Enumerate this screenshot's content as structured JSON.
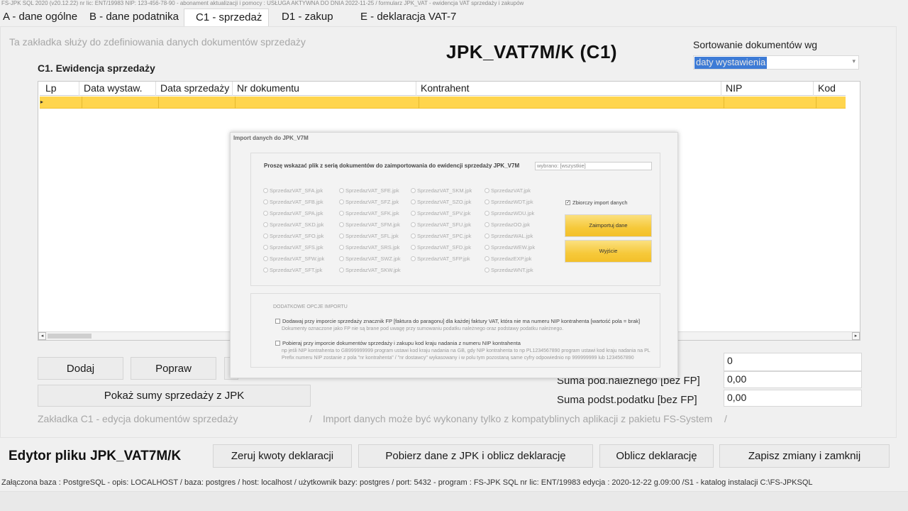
{
  "window": {
    "title": "FS-JPK SQL 2020  (v20.12.22)    nr lic: ENT/19983     NIP: 123-456-78-90      -     abonament aktualizacji i pomocy : USŁUGA AKTYWNA DO DNIA 2022-11-25      /      formularz JPK_VAT - ewidencja VAT sprzedaży i zakupów"
  },
  "tabs": [
    {
      "label": "A - dane ogólne"
    },
    {
      "label": "B   - dane podatnika"
    },
    {
      "label": "C1  - sprzedaż"
    },
    {
      "label": "D1   - zakup"
    },
    {
      "label": "E - deklaracja VAT-7"
    }
  ],
  "page": {
    "hint": "Ta zakładka służy do zdefiniowania danych dokumentów sprzedaży",
    "title": "JPK_VAT7M/K (C1)",
    "section_title": "C1. Ewidencja sprzedaży",
    "sort_label": "Sortowanie dokumentów wg",
    "sort_value": "daty wystawienia"
  },
  "grid": {
    "columns": [
      "Lp",
      "Data wystaw.",
      "Data sprzedaży",
      "Nr dokumentu",
      "Kontrahent",
      "NIP",
      "Kod"
    ]
  },
  "modal": {
    "title": "Import danych do JPK_V7M",
    "prompt": "Proszę wskazać plik z serią dokumentów do zaimportowania do ewidencji sprzedaży JPK_V7M",
    "filter_value": "wybrano: [wszystkie]",
    "files": [
      [
        "SprzedazVAT_SFA.jpk",
        "SprzedazVAT_SFE.jpk",
        "SprzedazVAT_SKM.jpk",
        "SprzedazVAT.jpk"
      ],
      [
        "SprzedazVAT_SFB.jpk",
        "SprzedazVAT_SFZ.jpk",
        "SprzedazVAT_SZO.jpk",
        "SprzedazWDT.jpk"
      ],
      [
        "SprzedazVAT_SPA.jpk",
        "SprzedazVAT_SFK.jpk",
        "SprzedazVAT_SPV.jpk",
        "SprzedazWDU.jpk"
      ],
      [
        "SprzedazVAT_SKD.jpk",
        "SprzedazVAT_SFM.jpk",
        "SprzedazVAT_SFU.jpk",
        "SprzedazOO.jpk"
      ],
      [
        "SprzedazVAT_SFO.jpk",
        "SprzedazVAT_SFL.jpk",
        "SprzedazVAT_SPC.jpk",
        "SprzedazWAL.jpk"
      ],
      [
        "SprzedazVAT_SFS.jpk",
        "SprzedazVAT_SRS.jpk",
        "SprzedazVAT_SFD.jpk",
        "SprzedazWEW.jpk"
      ],
      [
        "SprzedazVAT_SFW.jpk",
        "SprzedazVAT_SWZ.jpk",
        "SprzedazVAT_SFP.jpk",
        "SprzedazEXP.jpk"
      ],
      [
        "SprzedazVAT_SFT.jpk",
        "SprzedazVAT_SKW.jpk",
        "",
        "SprzedazWNT.jpk"
      ]
    ],
    "bulk_import_label": "Zbiorczy import danych",
    "import_button": "Zaimportuj dane",
    "exit_button": "Wyjście",
    "extra_header": "DODATKOWE OPCJE IMPORTU",
    "opt1_label": "Dodawaj przy imporcie sprzedaży znacznik FP [faktura do paragonu] dla każdej faktury VAT, która nie ma numeru NIP kontrahenta [wartość pola = brak]",
    "opt1_note": "Dokumenty oznaczone jako FP nie są brane pod uwagę przy sumowaniu podatku należnego oraz podstawy podatku należnego.",
    "opt2_label": "Pobieraj przy imporcie dokumentów sprzedaży i zakupu kod kraju nadania z numeru NIP kontrahenta",
    "opt2_note1": "np jeśli NIP kontrahenta to GB999999999 program ustawi kod kraju nadania na GB, gdy NIP kontrahenta to np PL1234567890 program ustawi kod kraju nadania na PL",
    "opt2_note2": "Prefix numeru NIP zostanie z pola \"nr kontrahenta\" / \"nr dostawcy\" wykasowany i w polu tym pozostaną same cyfry odpowiednio np  999999999 lub 1234567890"
  },
  "actions": {
    "add": "Dodaj",
    "edit": "Popraw",
    "show_sums": "Pokaż sumy sprzedaży z JPK"
  },
  "totals": {
    "count_value": "0",
    "due_tax_label": "Suma pod.należnego [bez FP]",
    "due_tax_value": "0,00",
    "tax_base_label": "Suma podst.podatku [bez FP]",
    "tax_base_value": "0,00"
  },
  "info_line": {
    "left": "Zakładka C1 - edycja dokumentów sprzedaży",
    "sep1": "/",
    "right": "Import danych może być wykonany tylko z kompatyblinych aplikacji z pakietu FS-System",
    "sep2": "/"
  },
  "footer": {
    "title": "Edytor pliku JPK_VAT7M/K",
    "reset": "Zeruj kwoty deklaracji",
    "fetch": "Pobierz dane z JPK i oblicz deklarację",
    "calc": "Oblicz deklarację",
    "save_close": "Zapisz zmiany i zamknij"
  },
  "status": {
    "text": "Załączona baza : PostgreSQL - opis: LOCALHOST  /  baza: postgres / host: localhost / użytkownik bazy: postgres /  port: 5432   -  program :  FS-JPK SQL  nr lic: ENT/19983  edycja : 2020-12-22 g.09:00 /S1 - katalog instalacji C:\\FS-JPKSQL"
  },
  "colors": {
    "selection": "#3d7bd6",
    "row_highlight": "#ffd54d",
    "button_yellow": "#f6c93a"
  }
}
